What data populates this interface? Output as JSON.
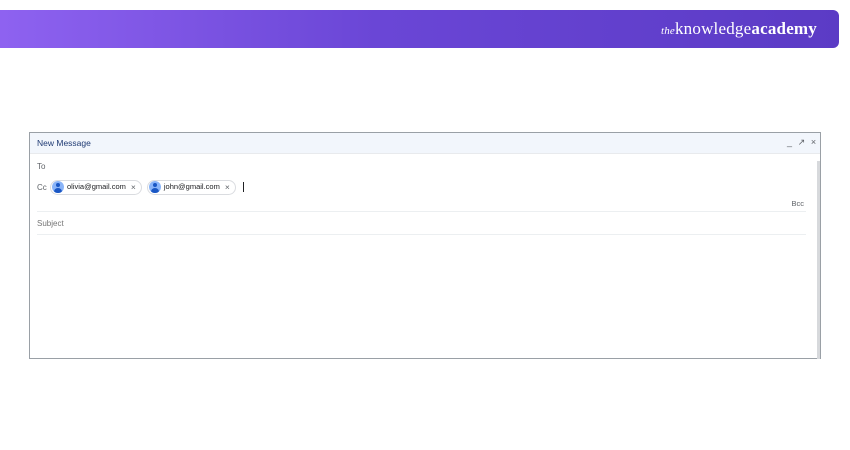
{
  "brand": {
    "prefix": "the",
    "middle": "knowledge",
    "suffix": "academy"
  },
  "compose": {
    "title": "New Message",
    "controls": {
      "minimize": "_",
      "expand": "↗",
      "close": "×"
    },
    "to_label": "To",
    "cc_label": "Cc",
    "cc_recipients": [
      {
        "email": "olivia@gmail.com",
        "remove": "×"
      },
      {
        "email": "john@gmail.com",
        "remove": "×"
      }
    ],
    "bcc_label": "Bcc",
    "subject_placeholder": "Subject"
  },
  "colors": {
    "banner_start": "#8e62f0",
    "banner_end": "#5b3bc5",
    "header_bg": "#f2f6fc"
  }
}
